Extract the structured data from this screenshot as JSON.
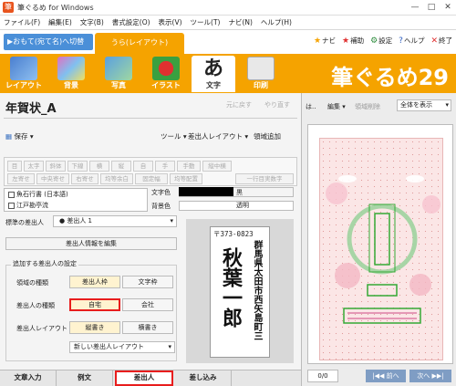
{
  "window": {
    "title": "筆ぐるめ for Windows",
    "min": "—",
    "max": "□",
    "close": "✕"
  },
  "menu": [
    "ファイル(F)",
    "編集(E)",
    "文字(B)",
    "書式設定(O)",
    "表示(V)",
    "ツール(T)",
    "ナビ(N)",
    "ヘルプ(H)"
  ],
  "top": {
    "switch_label": "おもて(宛て名)へ切替",
    "layout_tab": "うら(レイアウト)",
    "helps": [
      {
        "icon": "★",
        "label": "ナビ"
      },
      {
        "icon": "★",
        "label": "補助"
      },
      {
        "icon": "⚙",
        "label": "設定"
      },
      {
        "icon": "?",
        "label": "ヘルプ"
      },
      {
        "icon": "✕",
        "label": "終了"
      }
    ]
  },
  "toolbar": {
    "buttons": [
      "レイアウト",
      "背景",
      "写真",
      "イラスト",
      "文字",
      "印刷"
    ],
    "active": "文字",
    "brand": "筆ぐるめ29"
  },
  "editor": {
    "doc_title": "年賀状_A",
    "undo": "元に戻す",
    "redo": "やり直す",
    "save": "保存",
    "tools": "ツール",
    "sender_layout": "差出人レイアウト",
    "area_add": "領域追加",
    "format_row1": [
      "目",
      "太字",
      "斜体",
      "下線",
      "横",
      "縦",
      "自",
      "手",
      "手動",
      "縦中横"
    ],
    "format_row2": [
      "左寄せ",
      "中央寄せ",
      "右寄せ",
      "均等余白",
      "固定幅",
      "均等配置",
      "一行目実数字"
    ],
    "fonts": [
      "魚石行書 (日本語)",
      "江戸勘亭流"
    ],
    "color_label": "文字色",
    "color_name": "黒",
    "bg_label": "背景色",
    "bg_value": "透明",
    "sender_label": "標準の差出人",
    "sender_value": "● 差出人 1",
    "edit_sender": "差出人情報を編集",
    "add_settings": "追加する差出人の設定",
    "area_type": "領域の種類",
    "area_type_opts": [
      "差出人枠",
      "文字枠"
    ],
    "sender_type": "差出人の種類",
    "sender_type_opts": [
      "自宅",
      "会社"
    ],
    "sender_layout_label": "差出人レイアウト",
    "layout_opts": [
      "縦書き",
      "横書き"
    ],
    "new_layout": "新しい差出人レイアウト"
  },
  "card_preview": {
    "postal": "〒373-0823",
    "address": "群馬県太田市西矢島町三",
    "name": "秋葉一郎"
  },
  "bottom_tabs": [
    "文章入力",
    "例文",
    "差出人",
    "差し込み"
  ],
  "right_panel": {
    "label1": "は..",
    "edit": "編集",
    "delete": "領域削除",
    "zoom": "全体を表示",
    "page": "0/0",
    "prev": "|◀◀ 前へ",
    "next": "次へ ▶▶|"
  }
}
